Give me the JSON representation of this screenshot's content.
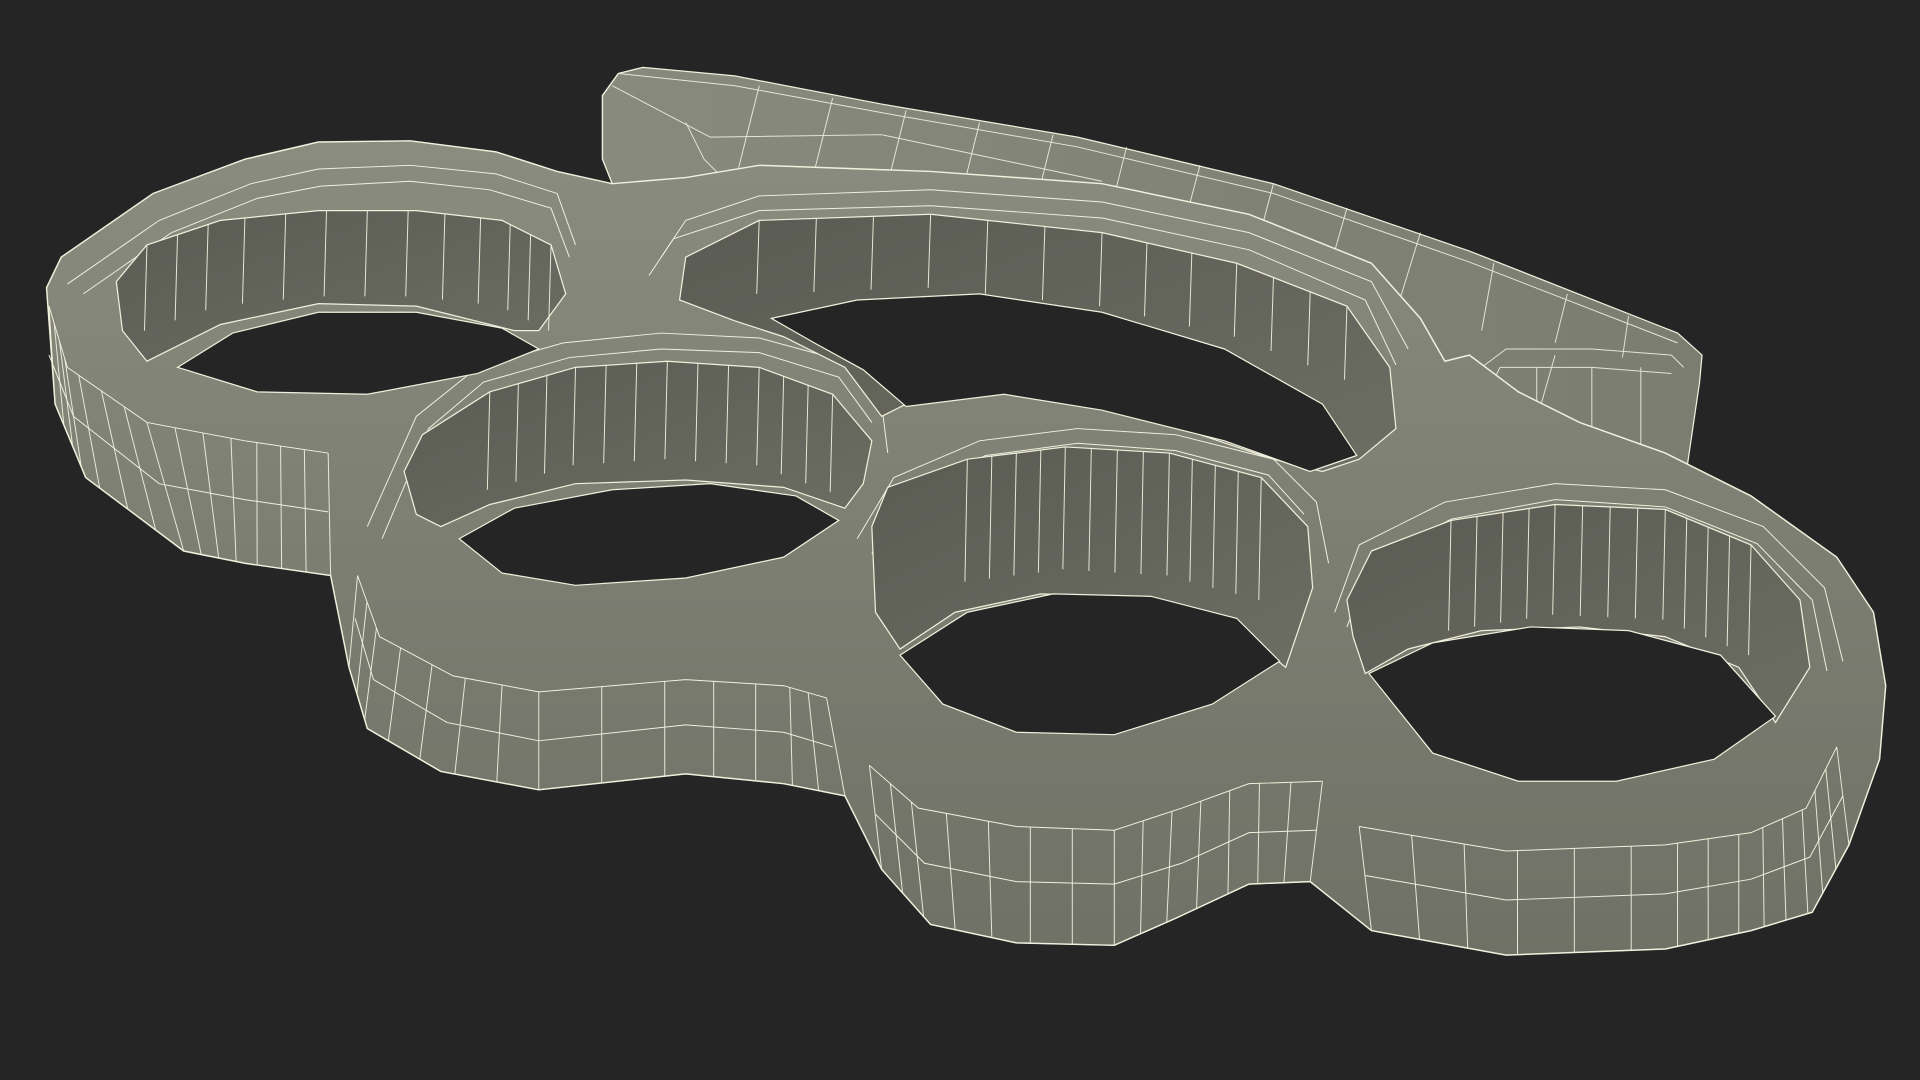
{
  "scene": {
    "subject": "brass-knuckles-wireframe",
    "colors": {
      "background": "#252525",
      "surface_light": "#85877a",
      "surface_mid": "#74766a",
      "surface_dark": "#5b5c53",
      "wire": "#f1f0dd",
      "hole": "#252525"
    },
    "finger_holes": 4
  }
}
